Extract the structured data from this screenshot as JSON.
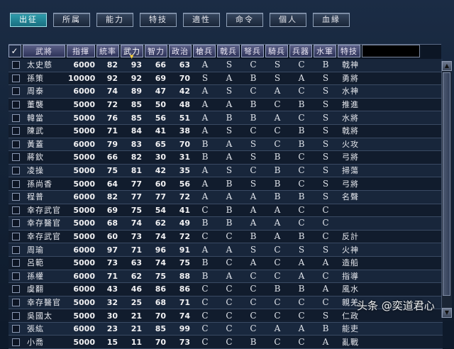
{
  "tabs": [
    {
      "label": "出征",
      "active": true
    },
    {
      "label": "所属",
      "active": false
    },
    {
      "label": "能力",
      "active": false
    },
    {
      "label": "特技",
      "active": false
    },
    {
      "label": "適性",
      "active": false
    },
    {
      "label": "命令",
      "active": false
    },
    {
      "label": "個人",
      "active": false
    },
    {
      "label": "血縁",
      "active": false
    }
  ],
  "columns": {
    "check": "✓",
    "name": "武將",
    "command": "指揮",
    "lead": "統率",
    "war": "武力",
    "int": "智力",
    "pol": "政治",
    "spear": "槍兵",
    "halberd": "戟兵",
    "crossbow": "弩兵",
    "cavalry": "騎兵",
    "weapon": "兵器",
    "navy": "水軍",
    "skill": "特技"
  },
  "sorted_column": "war",
  "rows": [
    {
      "name": "太史慈",
      "command": "6000",
      "lead": "82",
      "war": "93",
      "int": "66",
      "pol": "63",
      "spear": "A",
      "halberd": "S",
      "crossbow": "C",
      "cavalry": "S",
      "weapon": "C",
      "navy": "B",
      "skill": "戟神"
    },
    {
      "name": "孫策",
      "command": "10000",
      "lead": "92",
      "war": "92",
      "int": "69",
      "pol": "70",
      "spear": "S",
      "halberd": "A",
      "crossbow": "B",
      "cavalry": "S",
      "weapon": "A",
      "navy": "S",
      "skill": "勇將"
    },
    {
      "name": "周泰",
      "command": "6000",
      "lead": "74",
      "war": "89",
      "int": "47",
      "pol": "42",
      "spear": "A",
      "halberd": "S",
      "crossbow": "C",
      "cavalry": "A",
      "weapon": "C",
      "navy": "S",
      "skill": "水神"
    },
    {
      "name": "董襲",
      "command": "5000",
      "lead": "72",
      "war": "85",
      "int": "50",
      "pol": "48",
      "spear": "A",
      "halberd": "A",
      "crossbow": "B",
      "cavalry": "C",
      "weapon": "B",
      "navy": "S",
      "skill": "推進"
    },
    {
      "name": "韓當",
      "command": "5000",
      "lead": "76",
      "war": "85",
      "int": "56",
      "pol": "51",
      "spear": "A",
      "halberd": "B",
      "crossbow": "B",
      "cavalry": "A",
      "weapon": "C",
      "navy": "S",
      "skill": "水將"
    },
    {
      "name": "陳武",
      "command": "5000",
      "lead": "71",
      "war": "84",
      "int": "41",
      "pol": "38",
      "spear": "A",
      "halberd": "S",
      "crossbow": "C",
      "cavalry": "C",
      "weapon": "B",
      "navy": "S",
      "skill": "戟將"
    },
    {
      "name": "黃蓋",
      "command": "6000",
      "lead": "79",
      "war": "83",
      "int": "65",
      "pol": "70",
      "spear": "B",
      "halberd": "A",
      "crossbow": "S",
      "cavalry": "C",
      "weapon": "B",
      "navy": "S",
      "skill": "火攻"
    },
    {
      "name": "蔣欽",
      "command": "5000",
      "lead": "66",
      "war": "82",
      "int": "30",
      "pol": "31",
      "spear": "B",
      "halberd": "A",
      "crossbow": "S",
      "cavalry": "B",
      "weapon": "C",
      "navy": "S",
      "skill": "弓將"
    },
    {
      "name": "凌操",
      "command": "5000",
      "lead": "75",
      "war": "81",
      "int": "42",
      "pol": "35",
      "spear": "A",
      "halberd": "S",
      "crossbow": "C",
      "cavalry": "B",
      "weapon": "C",
      "navy": "S",
      "skill": "掃蕩"
    },
    {
      "name": "孫尚香",
      "command": "5000",
      "lead": "64",
      "war": "77",
      "int": "60",
      "pol": "56",
      "spear": "A",
      "halberd": "B",
      "crossbow": "S",
      "cavalry": "B",
      "weapon": "C",
      "navy": "S",
      "skill": "弓將"
    },
    {
      "name": "程普",
      "command": "6000",
      "lead": "82",
      "war": "77",
      "int": "77",
      "pol": "72",
      "spear": "A",
      "halberd": "A",
      "crossbow": "A",
      "cavalry": "B",
      "weapon": "B",
      "navy": "S",
      "skill": "名聲"
    },
    {
      "name": "幸存武官",
      "command": "5000",
      "lead": "69",
      "war": "75",
      "int": "54",
      "pol": "41",
      "spear": "C",
      "halberd": "B",
      "crossbow": "A",
      "cavalry": "A",
      "weapon": "C",
      "navy": "C",
      "skill": ""
    },
    {
      "name": "幸存醫官",
      "command": "5000",
      "lead": "68",
      "war": "74",
      "int": "62",
      "pol": "49",
      "spear": "B",
      "halberd": "B",
      "crossbow": "A",
      "cavalry": "A",
      "weapon": "C",
      "navy": "C",
      "skill": ""
    },
    {
      "name": "幸存武官",
      "command": "5000",
      "lead": "60",
      "war": "73",
      "int": "74",
      "pol": "72",
      "spear": "C",
      "halberd": "C",
      "crossbow": "B",
      "cavalry": "A",
      "weapon": "B",
      "navy": "C",
      "skill": "反計"
    },
    {
      "name": "周瑜",
      "command": "6000",
      "lead": "97",
      "war": "71",
      "int": "96",
      "pol": "91",
      "spear": "A",
      "halberd": "A",
      "crossbow": "S",
      "cavalry": "C",
      "weapon": "S",
      "navy": "S",
      "skill": "火神"
    },
    {
      "name": "呂範",
      "command": "5000",
      "lead": "73",
      "war": "63",
      "int": "74",
      "pol": "75",
      "spear": "B",
      "halberd": "C",
      "crossbow": "A",
      "cavalry": "C",
      "weapon": "A",
      "navy": "A",
      "skill": "造船"
    },
    {
      "name": "孫權",
      "command": "6000",
      "lead": "71",
      "war": "62",
      "int": "75",
      "pol": "88",
      "spear": "B",
      "halberd": "A",
      "crossbow": "C",
      "cavalry": "C",
      "weapon": "A",
      "navy": "C",
      "skill": "指導"
    },
    {
      "name": "虞翻",
      "command": "6000",
      "lead": "43",
      "war": "46",
      "int": "86",
      "pol": "86",
      "spear": "C",
      "halberd": "C",
      "crossbow": "C",
      "cavalry": "B",
      "weapon": "B",
      "navy": "A",
      "skill": "風水"
    },
    {
      "name": "幸存醫官",
      "command": "5000",
      "lead": "32",
      "war": "25",
      "int": "68",
      "pol": "71",
      "spear": "C",
      "halberd": "C",
      "crossbow": "C",
      "cavalry": "C",
      "weapon": "C",
      "navy": "C",
      "skill": "親羌"
    },
    {
      "name": "吳國太",
      "command": "5000",
      "lead": "30",
      "war": "21",
      "int": "70",
      "pol": "74",
      "spear": "C",
      "halberd": "C",
      "crossbow": "C",
      "cavalry": "C",
      "weapon": "C",
      "navy": "S",
      "skill": "仁政"
    },
    {
      "name": "張紘",
      "command": "6000",
      "lead": "23",
      "war": "21",
      "int": "85",
      "pol": "99",
      "spear": "C",
      "halberd": "C",
      "crossbow": "C",
      "cavalry": "A",
      "weapon": "A",
      "navy": "B",
      "skill": "能吏"
    },
    {
      "name": "小喬",
      "command": "5000",
      "lead": "15",
      "war": "11",
      "int": "70",
      "pol": "73",
      "spear": "C",
      "halberd": "C",
      "crossbow": "B",
      "cavalry": "C",
      "weapon": "C",
      "navy": "A",
      "skill": "亂戰"
    }
  ],
  "watermark": "头条 @奕道君心"
}
